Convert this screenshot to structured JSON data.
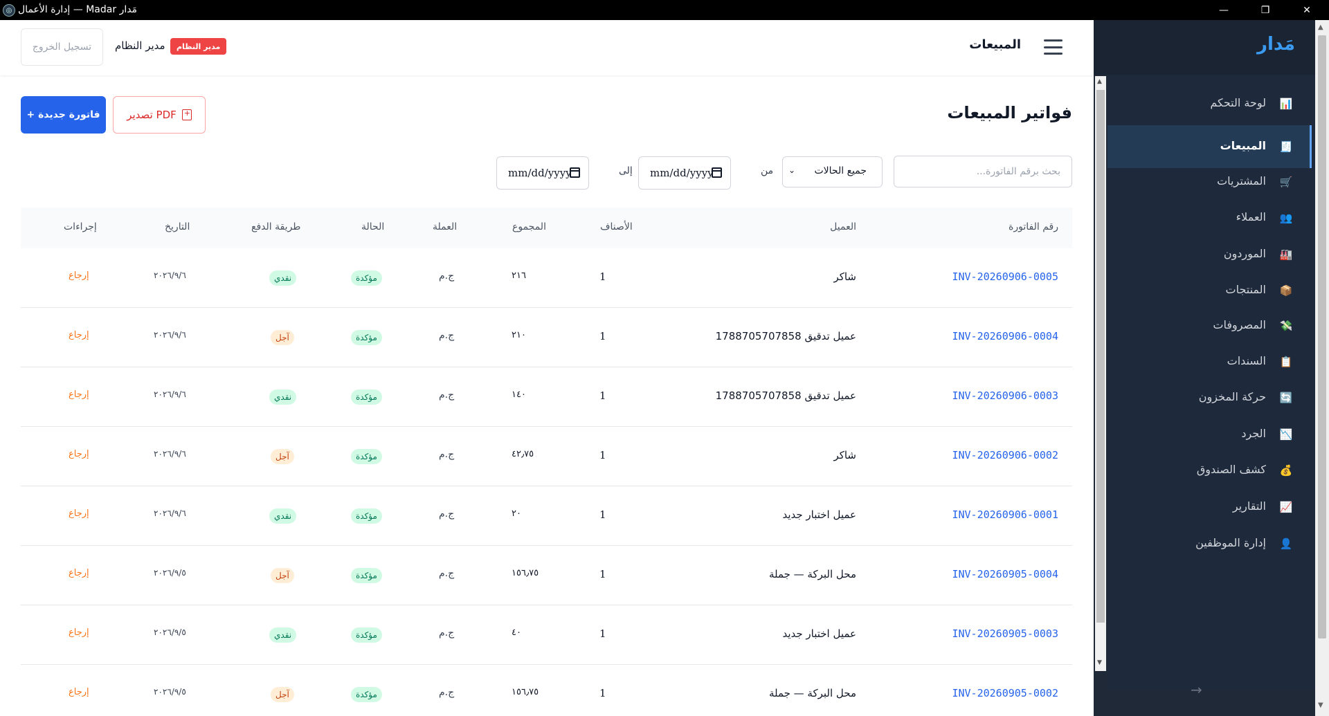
{
  "window": {
    "title": "إدارة الأعمال — Madar مَدار",
    "logo_glyph": "◎"
  },
  "sidebar": {
    "brand": "مَدار",
    "collapse_glyph": "→",
    "items": [
      {
        "label": "لوحة التحكم",
        "icon": "chart-icon",
        "glyph": "📊",
        "active": false
      },
      {
        "label": "المبيعات",
        "icon": "receipt-icon",
        "glyph": "🧾",
        "active": true
      },
      {
        "label": "المشتريات",
        "icon": "cart-icon",
        "glyph": "🛒",
        "active": false
      },
      {
        "label": "العملاء",
        "icon": "users-icon",
        "glyph": "👥",
        "active": false
      },
      {
        "label": "الموردون",
        "icon": "factory-icon",
        "glyph": "🏭",
        "active": false
      },
      {
        "label": "المنتجات",
        "icon": "box-icon",
        "glyph": "📦",
        "active": false
      },
      {
        "label": "المصروفات",
        "icon": "money-icon",
        "glyph": "💸",
        "active": false
      },
      {
        "label": "السندات",
        "icon": "clipboard-icon",
        "glyph": "📋",
        "active": false
      },
      {
        "label": "حركة المخزون",
        "icon": "refresh-icon",
        "glyph": "🔄",
        "active": false
      },
      {
        "label": "الجرد",
        "icon": "chart-down-icon",
        "glyph": "📉",
        "active": false
      },
      {
        "label": "كشف الصندوق",
        "icon": "money-bag-icon",
        "glyph": "💰",
        "active": false
      },
      {
        "label": "التقارير",
        "icon": "chart-up-icon",
        "glyph": "📈",
        "active": false
      },
      {
        "label": "إدارة الموظفين",
        "icon": "employee-icon",
        "glyph": "👤",
        "active": false
      }
    ]
  },
  "header": {
    "page_title": "المبيعات",
    "logout_label": "تسجيل الخروج",
    "user_name": "مدير النظام",
    "role_badge": "مدير النظام"
  },
  "main": {
    "heading": "فواتير المبيعات",
    "new_invoice_label": "+ فاتورة جديدة",
    "export_pdf_label": "تصدير PDF",
    "search_placeholder": "بحث برقم الفاتورة...",
    "status_filter": "جميع الحالات",
    "from_label": "من",
    "to_label": "إلى",
    "date_from": "mm/dd/yyyy",
    "date_to": "mm/dd/yyyy",
    "columns": {
      "invoice_no": "رقم الفاتورة",
      "customer": "العميل",
      "items": "الأصناف",
      "total": "المجموع",
      "currency": "العملة",
      "status": "الحالة",
      "payment": "طريقة الدفع",
      "date": "التاريخ",
      "actions": "إجراءات"
    },
    "rows": [
      {
        "invoice": "INV-20260906-0005",
        "customer": "شاكر",
        "items": "1",
        "total": "٢١٦",
        "currency": "ج.م",
        "status": "مؤكدة",
        "payment": "نقدي",
        "payment_type": "cash",
        "date": "٢٠٢٦/٩/٦",
        "action": "إرجاع"
      },
      {
        "invoice": "INV-20260906-0004",
        "customer": "عميل تدقيق 1788705707858",
        "items": "1",
        "total": "٢١٠",
        "currency": "ج.م",
        "status": "مؤكدة",
        "payment": "آجل",
        "payment_type": "credit",
        "date": "٢٠٢٦/٩/٦",
        "action": "إرجاع"
      },
      {
        "invoice": "INV-20260906-0003",
        "customer": "عميل تدقيق 1788705707858",
        "items": "1",
        "total": "١٤٠",
        "currency": "ج.م",
        "status": "مؤكدة",
        "payment": "نقدي",
        "payment_type": "cash",
        "date": "٢٠٢٦/٩/٦",
        "action": "إرجاع"
      },
      {
        "invoice": "INV-20260906-0002",
        "customer": "شاكر",
        "items": "1",
        "total": "٤٢٫٧٥",
        "currency": "ج.م",
        "status": "مؤكدة",
        "payment": "آجل",
        "payment_type": "credit",
        "date": "٢٠٢٦/٩/٦",
        "action": "إرجاع"
      },
      {
        "invoice": "INV-20260906-0001",
        "customer": "عميل اختبار جديد",
        "items": "1",
        "total": "٢٠",
        "currency": "ج.م",
        "status": "مؤكدة",
        "payment": "نقدي",
        "payment_type": "cash",
        "date": "٢٠٢٦/٩/٦",
        "action": "إرجاع"
      },
      {
        "invoice": "INV-20260905-0004",
        "customer": "محل البركة — جملة",
        "items": "1",
        "total": "١٥٦٫٧٥",
        "currency": "ج.م",
        "status": "مؤكدة",
        "payment": "آجل",
        "payment_type": "credit",
        "date": "٢٠٢٦/٩/٥",
        "action": "إرجاع"
      },
      {
        "invoice": "INV-20260905-0003",
        "customer": "عميل اختبار جديد",
        "items": "1",
        "total": "٤٠",
        "currency": "ج.م",
        "status": "مؤكدة",
        "payment": "نقدي",
        "payment_type": "cash",
        "date": "٢٠٢٦/٩/٥",
        "action": "إرجاع"
      },
      {
        "invoice": "INV-20260905-0002",
        "customer": "محل البركة — جملة",
        "items": "1",
        "total": "١٥٦٫٧٥",
        "currency": "ج.م",
        "status": "مؤكدة",
        "payment": "آجل",
        "payment_type": "credit",
        "date": "٢٠٢٦/٩/٥",
        "action": "إرجاع"
      }
    ]
  },
  "colors": {
    "accent": "#2563eb",
    "sidebar_bg": "#1f2937",
    "brand": "#3b9bf0",
    "danger": "#ef4444",
    "confirmed_bg": "#d1fae5",
    "credit_bg": "#ffedd5"
  }
}
